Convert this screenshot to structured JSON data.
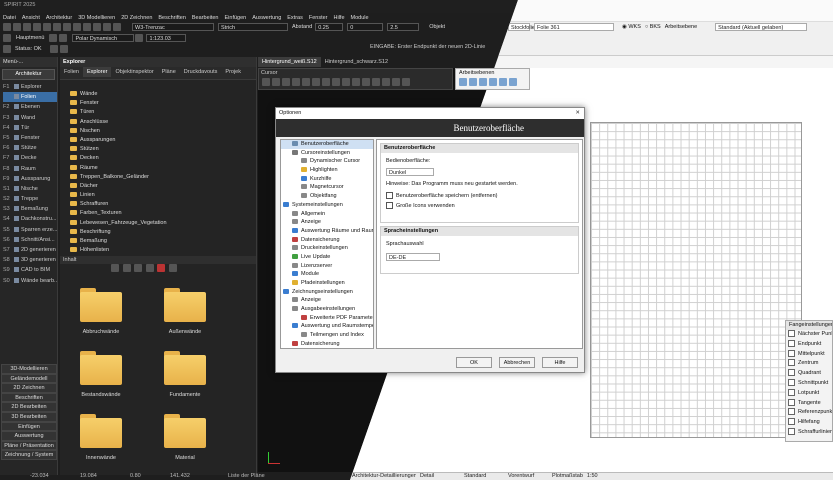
{
  "app": {
    "title": "SPIRIT 2025"
  },
  "menu": [
    "Datei",
    "Ansicht",
    "Architektur",
    "3D Modellieren",
    "2D Zeichnen",
    "Beschriften",
    "Bearbeiten",
    "Einfügen",
    "Auswertung",
    "Extras",
    "Fenster",
    "Hilfe",
    "Module"
  ],
  "toolbar": {
    "line_type": "W3-Trenzac",
    "pen": "Strich",
    "abstand_label": "Abstand",
    "abstand_value": "0.25",
    "field_zero": "0",
    "field_thickness": "2.5",
    "layer_prefix": "Objekt",
    "layer_value": "Stockfolie",
    "folie_value": "Folie 361",
    "wks_label": "WKS",
    "bks_label": "BKS",
    "plane_label": "Arbeitsebene",
    "standard_value": "Standard (Aktuell gelaben)"
  },
  "toolbar2": {
    "hauptmenu": "Hauptmenü",
    "pen_value": "Polar Dynamisch",
    "scale_value": "1:123.03",
    "status_label": "Status: OK"
  },
  "prompt": {
    "text": "EINGABE: Erster Endpunkt der neuen 2D-Linie"
  },
  "left_panel": {
    "header": "Menü-...",
    "category": "Architektur",
    "items": [
      {
        "key": "F1",
        "label": "Explorer"
      },
      {
        "key": "",
        "label": "Folien"
      },
      {
        "key": "F2",
        "label": "Ebenen"
      },
      {
        "key": "F3",
        "label": "Wand"
      },
      {
        "key": "F4",
        "label": "Tür"
      },
      {
        "key": "F5",
        "label": "Fenster"
      },
      {
        "key": "F6",
        "label": "Stütze"
      },
      {
        "key": "F7",
        "label": "Decke"
      },
      {
        "key": "F8",
        "label": "Raum"
      },
      {
        "key": "F9",
        "label": "Aussparung"
      },
      {
        "key": "S1",
        "label": "Nische"
      },
      {
        "key": "S2",
        "label": "Treppe"
      },
      {
        "key": "S3",
        "label": "Bemaßung"
      },
      {
        "key": "S4",
        "label": "Dachkonstru..."
      },
      {
        "key": "S5",
        "label": "Sparren erze..."
      },
      {
        "key": "S6",
        "label": "Schnitt/Ansi..."
      },
      {
        "key": "S7",
        "label": "2D generieren"
      },
      {
        "key": "S8",
        "label": "3D generieren"
      },
      {
        "key": "S9",
        "label": "CAD to BIM"
      },
      {
        "key": "S0",
        "label": "Wände bearb..."
      }
    ],
    "bottom_buttons": [
      "3D-Modellieren",
      "Geländemodell",
      "2D Zeichnen",
      "Beschriften",
      "2D Bearbeiten",
      "3D Bearbeiten",
      "Einfügen",
      "Auswertung",
      "Pläne / Präsentation",
      "Zeichnung / System"
    ]
  },
  "explorer": {
    "title": "Explorer",
    "tabs": [
      "Folien",
      "Explorer",
      "Objektinspektor",
      "Pläne",
      "Druckdavouts",
      "Projek"
    ],
    "tree": [
      "Wände",
      "Fenster",
      "Türen",
      "Anschlüsse",
      "Nischen",
      "Aussparungen",
      "Stützen",
      "Decken",
      "Räume",
      "Treppen_Balkone_Geländer",
      "Dächer",
      "Linien",
      "Schraffuren",
      "Farben_Texturen",
      "Lebewesen_Fahrzeuge_Vegetation",
      "Beschriftung",
      "Bemaßung",
      "Höhenlisten"
    ],
    "inhalt_label": "Inhalt",
    "thumbnails": [
      "Abbruchwände",
      "Außenwände",
      "Bestandswände",
      "Fundamente",
      "Innenwände",
      "Material"
    ]
  },
  "doc_tabs": [
    "Hintergrund_weiß.S12",
    "Hintergrund_schwarz.S12"
  ],
  "cursor_panel": {
    "title": "Cursor"
  },
  "workplane_panel": {
    "title": "Arbeitsebenen"
  },
  "options": {
    "window_title": "Optionen",
    "heading": "Benutzeroberfläche",
    "tree": [
      {
        "label": "Benutzeroberfläche",
        "level": 1,
        "color": "#6a8caf"
      },
      {
        "label": "Cursoreinstellungen",
        "level": 1,
        "color": "#777"
      },
      {
        "label": "Dynamischer Cursor",
        "level": 2,
        "color": "#888"
      },
      {
        "label": "Highlighten",
        "level": 2,
        "color": "#e0b030"
      },
      {
        "label": "Kurzhilfe",
        "level": 2,
        "color": "#3a7dd0"
      },
      {
        "label": "Magnetcursor",
        "level": 2,
        "color": "#888"
      },
      {
        "label": "Objektfang",
        "level": 2,
        "color": "#888"
      },
      {
        "label": "Systemeinstellungen",
        "level": 0,
        "color": "#3a7dd0"
      },
      {
        "label": "Allgemein",
        "level": 1,
        "color": "#888"
      },
      {
        "label": "Anzeige",
        "level": 1,
        "color": "#888"
      },
      {
        "label": "Auswertung Räume und Raum",
        "level": 1,
        "color": "#3a7dd0"
      },
      {
        "label": "Datensicherung",
        "level": 1,
        "color": "#c04040"
      },
      {
        "label": "Druckeinstellungen",
        "level": 1,
        "color": "#888"
      },
      {
        "label": "Live Update",
        "level": 1,
        "color": "#40a040"
      },
      {
        "label": "Lizenzserver",
        "level": 1,
        "color": "#888"
      },
      {
        "label": "Module",
        "level": 1,
        "color": "#3a7dd0"
      },
      {
        "label": "Pfadeinstellungen",
        "level": 1,
        "color": "#e0b030"
      },
      {
        "label": "Zeichnungseinstellungen",
        "level": 0,
        "color": "#3a7dd0"
      },
      {
        "label": "Anzeige",
        "level": 1,
        "color": "#888"
      },
      {
        "label": "Ausgabeeinstellungen",
        "level": 1,
        "color": "#888"
      },
      {
        "label": "Erweiterte PDF Parameter",
        "level": 2,
        "color": "#c04040"
      },
      {
        "label": "Auswertung und Raumstempe",
        "level": 1,
        "color": "#3a7dd0"
      },
      {
        "label": "Teilmengen und Index",
        "level": 2,
        "color": "#888"
      },
      {
        "label": "Datensicherung",
        "level": 1,
        "color": "#c04040"
      }
    ],
    "section_ui": "Benutzeroberfläche",
    "design_label": "Bedienoberfläche:",
    "design_value": "Dunkel",
    "hint": "Hinweise: Das Programm muss neu gestartet werden.",
    "check1": "Benutzeroberfläche speichern (entfernen)",
    "check2": "Große Icons verwenden",
    "section_lang": "Spracheinstellungen",
    "lang_label": "Sprachauswahl",
    "lang_value": "DE-DE",
    "ok": "OK",
    "cancel": "Abbrechen",
    "help": "Hilfe"
  },
  "snap_panel": {
    "title": "Fangeinstellungen",
    "items": [
      "Nächster Punkt",
      "Endpunkt",
      "Mittelpunkt",
      "Zentrum",
      "Quadrant",
      "Schnittpunkt",
      "Lotpunkt",
      "Tangente",
      "Referenzpunkt",
      "Hilfefang",
      "Schraffurlinien"
    ]
  },
  "statusbar": {
    "x": "-23.034",
    "y": "19.084",
    "z": "0.80",
    "w": "141.432",
    "plan_list": "Liste der Pläne",
    "view": "Architektur-Detaillierungen",
    "detail": "Detail",
    "standard": "Standard",
    "preview": "Vorentwurf",
    "scale_label": "Plotmaßstab",
    "scale": "1:50"
  }
}
